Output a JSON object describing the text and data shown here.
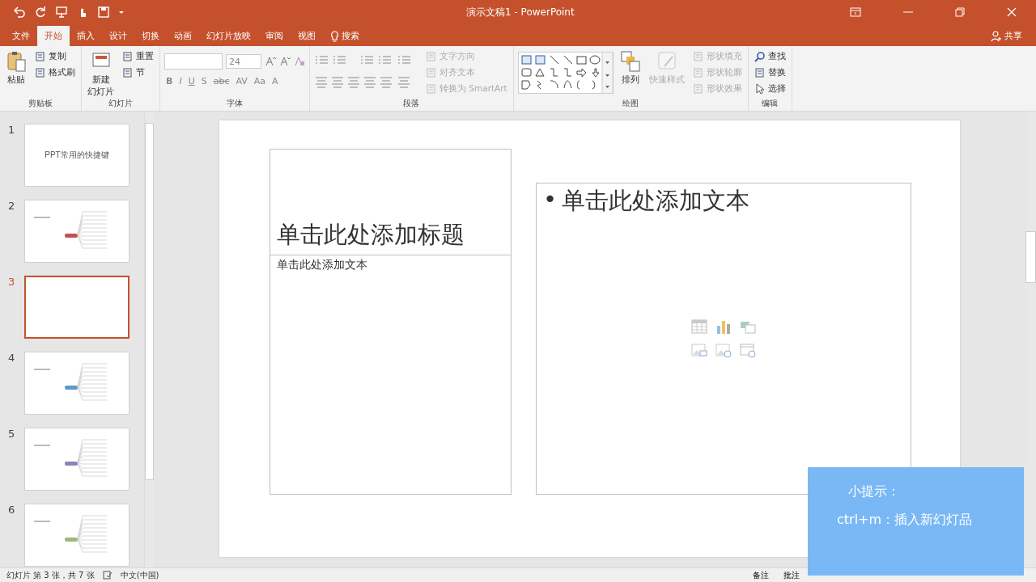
{
  "window": {
    "title": "演示文稿1 - PowerPoint"
  },
  "menu_tabs": [
    {
      "label": "文件",
      "selected": false
    },
    {
      "label": "开始",
      "selected": true
    },
    {
      "label": "插入",
      "selected": false
    },
    {
      "label": "设计",
      "selected": false
    },
    {
      "label": "切换",
      "selected": false
    },
    {
      "label": "动画",
      "selected": false
    },
    {
      "label": "幻灯片放映",
      "selected": false
    },
    {
      "label": "审阅",
      "selected": false
    },
    {
      "label": "视图",
      "selected": false
    }
  ],
  "search": {
    "label": "搜索"
  },
  "share": {
    "label": "共享"
  },
  "ribbon_groups": [
    {
      "title": "剪贴板",
      "sections": [
        {
          "kind": "large",
          "lines": [
            "粘贴"
          ],
          "disabled": false
        },
        {
          "kind": "stack",
          "items": [
            {
              "label": "复制",
              "disabled": false
            },
            {
              "label": "格式刷",
              "disabled": false
            }
          ]
        }
      ]
    },
    {
      "title": "幻灯片",
      "sections": [
        {
          "kind": "large",
          "lines": [
            "新建",
            "幻灯片"
          ],
          "disabled": false
        },
        {
          "kind": "stack",
          "items": [
            {
              "label": "重置",
              "disabled": false
            },
            {
              "label": "节",
              "disabled": false
            }
          ]
        }
      ]
    },
    {
      "title": "字体",
      "sections": [
        {
          "kind": "font",
          "size": "24",
          "buttons": [
            "B",
            "I",
            "U",
            "S",
            "abc",
            "AV",
            "Aa",
            "A"
          ]
        }
      ]
    },
    {
      "title": "段落",
      "sections": [
        {
          "kind": "paragraph"
        },
        {
          "kind": "stack",
          "items": [
            {
              "label": "文字方向",
              "disabled": true
            },
            {
              "label": "对齐文本",
              "disabled": true
            },
            {
              "label": "转换为 SmartArt",
              "disabled": true
            }
          ]
        }
      ]
    },
    {
      "title": "绘图",
      "sections": [
        {
          "kind": "gallery"
        },
        {
          "kind": "large",
          "lines": [
            "排列"
          ],
          "disabled": false
        },
        {
          "kind": "large",
          "lines": [
            "快速样式"
          ],
          "disabled": true
        },
        {
          "kind": "stack",
          "items": [
            {
              "label": "形状填充",
              "disabled": true
            },
            {
              "label": "形状轮廓",
              "disabled": true
            },
            {
              "label": "形状效果",
              "disabled": true
            }
          ]
        }
      ]
    },
    {
      "title": "编辑",
      "sections": [
        {
          "kind": "stack",
          "items": [
            {
              "label": "查找",
              "disabled": false
            },
            {
              "label": "替换",
              "disabled": false
            },
            {
              "label": "选择",
              "disabled": false
            }
          ]
        }
      ]
    }
  ],
  "thumbnails": [
    {
      "number": "1",
      "selected": false,
      "kind": "title",
      "title": "PPT常用的快捷键"
    },
    {
      "number": "2",
      "selected": false,
      "kind": "diagram",
      "color": "#c0505a"
    },
    {
      "number": "3",
      "selected": true,
      "kind": "blank"
    },
    {
      "number": "4",
      "selected": false,
      "kind": "diagram",
      "color": "#5b9bc8"
    },
    {
      "number": "5",
      "selected": false,
      "kind": "diagram",
      "color": "#8a84b8"
    },
    {
      "number": "6",
      "selected": false,
      "kind": "diagram",
      "color": "#9cb87a"
    }
  ],
  "slide": {
    "title_placeholder": "单击此处添加标题",
    "text_placeholder": "单击此处添加文本",
    "content_bullet": "•",
    "content_placeholder": "单击此处添加文本"
  },
  "tip": {
    "title": "小提示：",
    "text": "ctrl+m：插入新幻灯品"
  },
  "status_bar": {
    "slide_info": "幻灯片 第 3 张，共 7 张",
    "language": "中文(中国)",
    "notes": "备注",
    "comments": "批注"
  }
}
